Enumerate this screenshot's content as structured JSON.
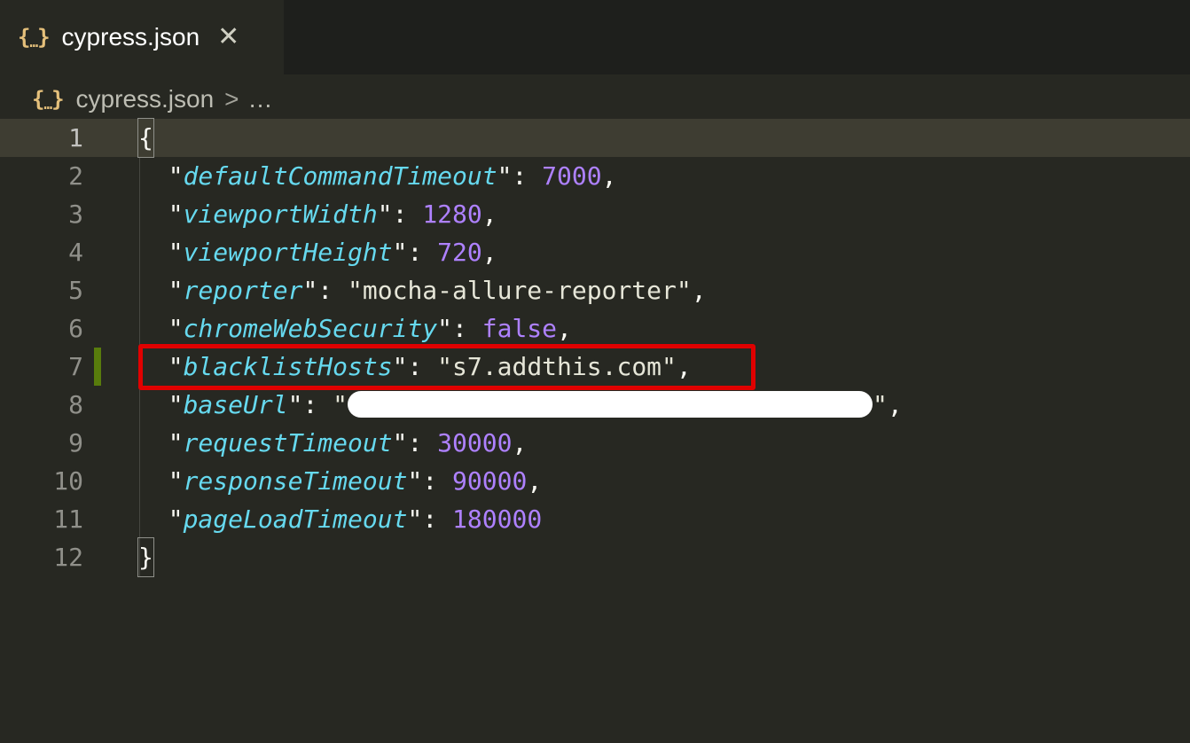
{
  "tab": {
    "icon": "json-braces-icon",
    "title": "cypress.json",
    "close_glyph": "✕"
  },
  "breadcrumb": {
    "icon": "json-braces-icon",
    "file": "cypress.json",
    "separator": ">",
    "more": "…"
  },
  "editor": {
    "current_line": 1,
    "modified_line": 7,
    "highlighted_line": 7,
    "highlight_color": "#e00000",
    "lines": [
      {
        "n": "1",
        "open": "{"
      },
      {
        "n": "2",
        "key": "defaultCommandTimeout",
        "value": "7000",
        "type": "number",
        "trail": ","
      },
      {
        "n": "3",
        "key": "viewportWidth",
        "value": "1280",
        "type": "number",
        "trail": ","
      },
      {
        "n": "4",
        "key": "viewportHeight",
        "value": "720",
        "type": "number",
        "trail": ","
      },
      {
        "n": "5",
        "key": "reporter",
        "value": "mocha-allure-reporter",
        "type": "string",
        "trail": ","
      },
      {
        "n": "6",
        "key": "chromeWebSecurity",
        "value": "false",
        "type": "boolean",
        "trail": ","
      },
      {
        "n": "7",
        "key": "blacklistHosts",
        "value": "s7.addthis.com",
        "type": "string",
        "trail": ","
      },
      {
        "n": "8",
        "key": "baseUrl",
        "value": "",
        "type": "redacted",
        "trail": ","
      },
      {
        "n": "9",
        "key": "requestTimeout",
        "value": "30000",
        "type": "number",
        "trail": ","
      },
      {
        "n": "10",
        "key": "responseTimeout",
        "value": "90000",
        "type": "number",
        "trail": ","
      },
      {
        "n": "11",
        "key": "pageLoadTimeout",
        "value": "180000",
        "type": "number",
        "trail": ""
      },
      {
        "n": "12",
        "close": "}"
      }
    ]
  }
}
